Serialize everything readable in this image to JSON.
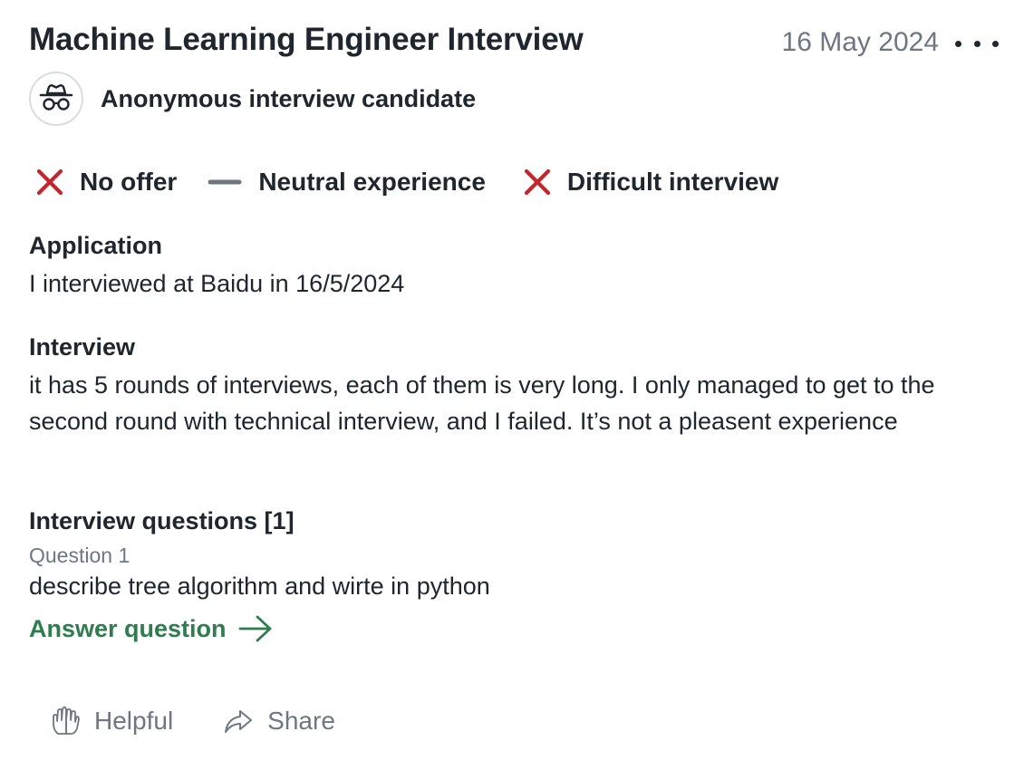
{
  "review": {
    "title": "Machine Learning Engineer Interview",
    "date": "16 May 2024",
    "more_icon": "more-horizontal-icon"
  },
  "author": {
    "avatar_icon": "anonymous-spy-icon",
    "name": "Anonymous interview candidate"
  },
  "ratings": [
    {
      "label": "No offer",
      "icon": "x-icon",
      "color": "#c1272d"
    },
    {
      "label": "Neutral experience",
      "icon": "dash-icon",
      "color": "#6e7681"
    },
    {
      "label": "Difficult interview",
      "icon": "x-icon",
      "color": "#c1272d"
    }
  ],
  "application": {
    "heading": "Application",
    "text": "I interviewed at Baidu in 16/5/2024"
  },
  "interview": {
    "heading": "Interview",
    "text": "it has 5 rounds of interviews, each of them is very long. I only managed to get to the second round with technical interview, and I failed. It’s not a pleasent experience"
  },
  "questions": {
    "heading": "Interview questions [1]",
    "items": [
      {
        "label": "Question 1",
        "text": "describe tree algorithm and wirte in python"
      }
    ],
    "answer_label": "Answer question",
    "answer_icon": "arrow-right-icon",
    "accent_color": "#2f7d4f"
  },
  "actions": {
    "helpful_label": "Helpful",
    "helpful_icon": "high-five-icon",
    "share_label": "Share",
    "share_icon": "share-arrow-icon"
  }
}
